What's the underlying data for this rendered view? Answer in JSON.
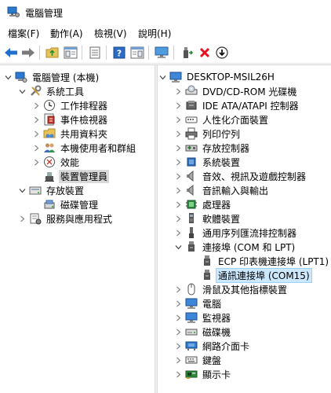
{
  "window": {
    "title": "電腦管理"
  },
  "menu": [
    {
      "label": "檔案(F)"
    },
    {
      "label": "動作(A)"
    },
    {
      "label": "檢視(V)"
    },
    {
      "label": "說明(H)"
    }
  ],
  "toolbar": {
    "buttons": [
      {
        "name": "back-button",
        "icon": "arrow-left-icon"
      },
      {
        "name": "forward-button",
        "icon": "arrow-right-icon"
      },
      {
        "name": "up-folder-button",
        "icon": "folder-up-icon"
      },
      {
        "name": "show-hide-tree-button",
        "icon": "console-tree-icon"
      },
      {
        "name": "properties-list-button",
        "icon": "list-icon"
      },
      {
        "name": "help-button",
        "icon": "help-icon"
      },
      {
        "name": "action-pane-button",
        "icon": "pane-icon"
      },
      {
        "name": "scan-hardware-button",
        "icon": "monitor-icon"
      },
      {
        "name": "update-driver-button",
        "icon": "update-driver-icon"
      },
      {
        "name": "uninstall-button",
        "icon": "red-x-icon"
      },
      {
        "name": "disable-button",
        "icon": "down-arrow-circle-icon"
      }
    ]
  },
  "left_tree": [
    {
      "label": "電腦管理 (本機)",
      "icon": "computer-management-icon",
      "expander": "down",
      "indent": 0
    },
    {
      "label": "系統工具",
      "icon": "tools-icon",
      "expander": "down",
      "indent": 1
    },
    {
      "label": "工作排程器",
      "icon": "clock-icon",
      "expander": "right",
      "indent": 2
    },
    {
      "label": "事件檢視器",
      "icon": "event-viewer-icon",
      "expander": "right",
      "indent": 2
    },
    {
      "label": "共用資料夾",
      "icon": "shared-folder-icon",
      "expander": "right",
      "indent": 2
    },
    {
      "label": "本機使用者和群組",
      "icon": "users-icon",
      "expander": "right",
      "indent": 2
    },
    {
      "label": "效能",
      "icon": "performance-icon",
      "expander": "right",
      "indent": 2
    },
    {
      "label": "裝置管理員",
      "icon": "device-manager-icon",
      "expander": "none",
      "indent": 2,
      "selected": true
    },
    {
      "label": "存放裝置",
      "icon": "storage-icon",
      "expander": "down",
      "indent": 1
    },
    {
      "label": "磁碟管理",
      "icon": "disk-management-icon",
      "expander": "none",
      "indent": 2
    },
    {
      "label": "服務與應用程式",
      "icon": "services-icon",
      "expander": "right",
      "indent": 1
    }
  ],
  "right_tree": [
    {
      "label": "DESKTOP-MSIL26H",
      "icon": "computer-icon",
      "expander": "down",
      "indent": 0
    },
    {
      "label": "DVD/CD-ROM 光碟機",
      "icon": "dvd-icon",
      "expander": "right",
      "indent": 1
    },
    {
      "label": "IDE ATA/ATAPI 控制器",
      "icon": "ide-icon",
      "expander": "right",
      "indent": 1
    },
    {
      "label": "人性化介面裝置",
      "icon": "hid-icon",
      "expander": "right",
      "indent": 1
    },
    {
      "label": "列印佇列",
      "icon": "printer-icon",
      "expander": "right",
      "indent": 1
    },
    {
      "label": "存放控制器",
      "icon": "storage-controller-icon",
      "expander": "right",
      "indent": 1
    },
    {
      "label": "系統裝置",
      "icon": "system-devices-icon",
      "expander": "right",
      "indent": 1
    },
    {
      "label": "音效、視訊及遊戲控制器",
      "icon": "speaker-icon",
      "expander": "right",
      "indent": 1
    },
    {
      "label": "音訊輸入與輸出",
      "icon": "speaker-icon",
      "expander": "right",
      "indent": 1
    },
    {
      "label": "處理器",
      "icon": "processor-icon",
      "expander": "right",
      "indent": 1
    },
    {
      "label": "軟體裝置",
      "icon": "software-device-icon",
      "expander": "right",
      "indent": 1
    },
    {
      "label": "通用序列匯流排控制器",
      "icon": "usb-icon",
      "expander": "right",
      "indent": 1
    },
    {
      "label": "連接埠 (COM 和 LPT)",
      "icon": "port-icon",
      "expander": "down",
      "indent": 1
    },
    {
      "label": "ECP 印表機連接埠 (LPT1)",
      "icon": "port-icon",
      "expander": "none",
      "indent": 2
    },
    {
      "label": "通訊連接埠 (COM15)",
      "icon": "port-icon",
      "expander": "none",
      "indent": 2,
      "selected": true
    },
    {
      "label": "滑鼠及其他指標裝置",
      "icon": "mouse-icon",
      "expander": "right",
      "indent": 1
    },
    {
      "label": "電腦",
      "icon": "monitor-icon",
      "expander": "right",
      "indent": 1
    },
    {
      "label": "監視器",
      "icon": "monitor-icon",
      "expander": "right",
      "indent": 1
    },
    {
      "label": "磁碟機",
      "icon": "disk-drive-icon",
      "expander": "right",
      "indent": 1
    },
    {
      "label": "網路介面卡",
      "icon": "network-adapter-icon",
      "expander": "right",
      "indent": 1
    },
    {
      "label": "鍵盤",
      "icon": "keyboard-icon",
      "expander": "right",
      "indent": 1
    },
    {
      "label": "顯示卡",
      "icon": "display-adapter-icon",
      "expander": "right",
      "indent": 1
    }
  ],
  "colors": {
    "selection_bg": "#cce8ff",
    "selection_gray": "#d9d9d9",
    "accent_blue": "#2b79d0",
    "red": "#e81123"
  }
}
